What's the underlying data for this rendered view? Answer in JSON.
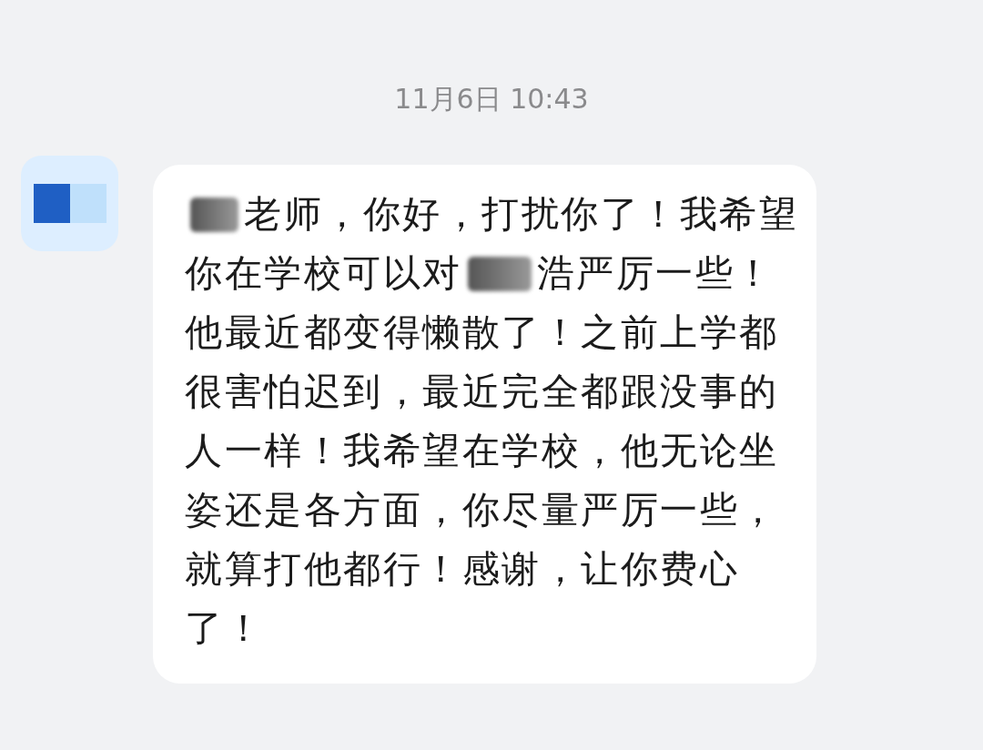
{
  "timestamp": "11月6日 10:43",
  "message": {
    "sender_avatar": {
      "kind": "redacted"
    },
    "lines": [
      [
        {
          "kind": "redacted"
        },
        {
          "kind": "text",
          "text": "老师，你好，打扰你了！我希望"
        }
      ],
      [
        {
          "kind": "text",
          "text": "你在学校可以对"
        },
        {
          "kind": "redacted"
        },
        {
          "kind": "text",
          "text": "浩严厉一些！"
        }
      ],
      [
        {
          "kind": "text",
          "text": "他最近都变得懒散了！之前上学都"
        }
      ],
      [
        {
          "kind": "text",
          "text": "很害怕迟到，最近完全都跟没事的"
        }
      ],
      [
        {
          "kind": "text",
          "text": "人一样！我希望在学校，他无论坐"
        }
      ],
      [
        {
          "kind": "text",
          "text": "姿还是各方面，你尽量严厉一些，"
        }
      ],
      [
        {
          "kind": "text",
          "text": "就算打他都行！感谢，让你费心"
        }
      ],
      [
        {
          "kind": "text",
          "text": "了！"
        }
      ]
    ]
  }
}
